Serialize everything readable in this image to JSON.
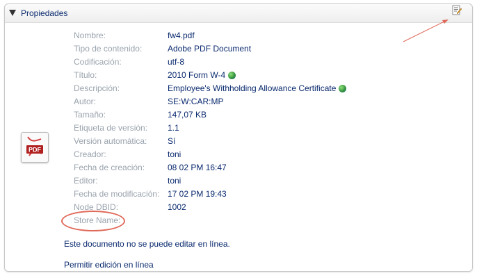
{
  "panel": {
    "title": "Propiedades",
    "toggle_icon": "triangle-down-icon",
    "edit_icon": "edit-properties-icon"
  },
  "file_icon": {
    "icon": "pdf-file-icon",
    "label": "PDF"
  },
  "properties": [
    {
      "label": "Nombre:",
      "value": "fw4.pdf"
    },
    {
      "label": "Tipo de contenido:",
      "value": "Adobe PDF Document"
    },
    {
      "label": "Codificación:",
      "value": "utf-8"
    },
    {
      "label": "Título:",
      "value": "2010 Form W-4"
    },
    {
      "label": "Descripción:",
      "value": "Employee's Withholding Allowance Certificate"
    },
    {
      "label": "Autor:",
      "value": "SE:W:CAR:MP"
    },
    {
      "label": "Tamaño:",
      "value": "147,07 KB"
    },
    {
      "label": "Etiqueta de versión:",
      "value": "1.1"
    },
    {
      "label": "Versión automática:",
      "value": "Sí"
    },
    {
      "label": "Creador:",
      "value": "toni"
    },
    {
      "label": "Fecha de creación:",
      "value": "08 02 PM 16:47"
    },
    {
      "label": "Editor:",
      "value": "toni"
    },
    {
      "label": "Fecha de modificación:",
      "value": "17 02 PM 19:43"
    },
    {
      "label": "Node DBID:",
      "value": "1002"
    },
    {
      "label": "Store Name:",
      "value": ""
    }
  ],
  "notice": "Este documento no se puede editar en línea.",
  "enable_link": "Permitir edición en línea",
  "colors": {
    "label": "#9aa3ad",
    "value": "#0a2a6e",
    "annotation": "#e06a5a"
  }
}
